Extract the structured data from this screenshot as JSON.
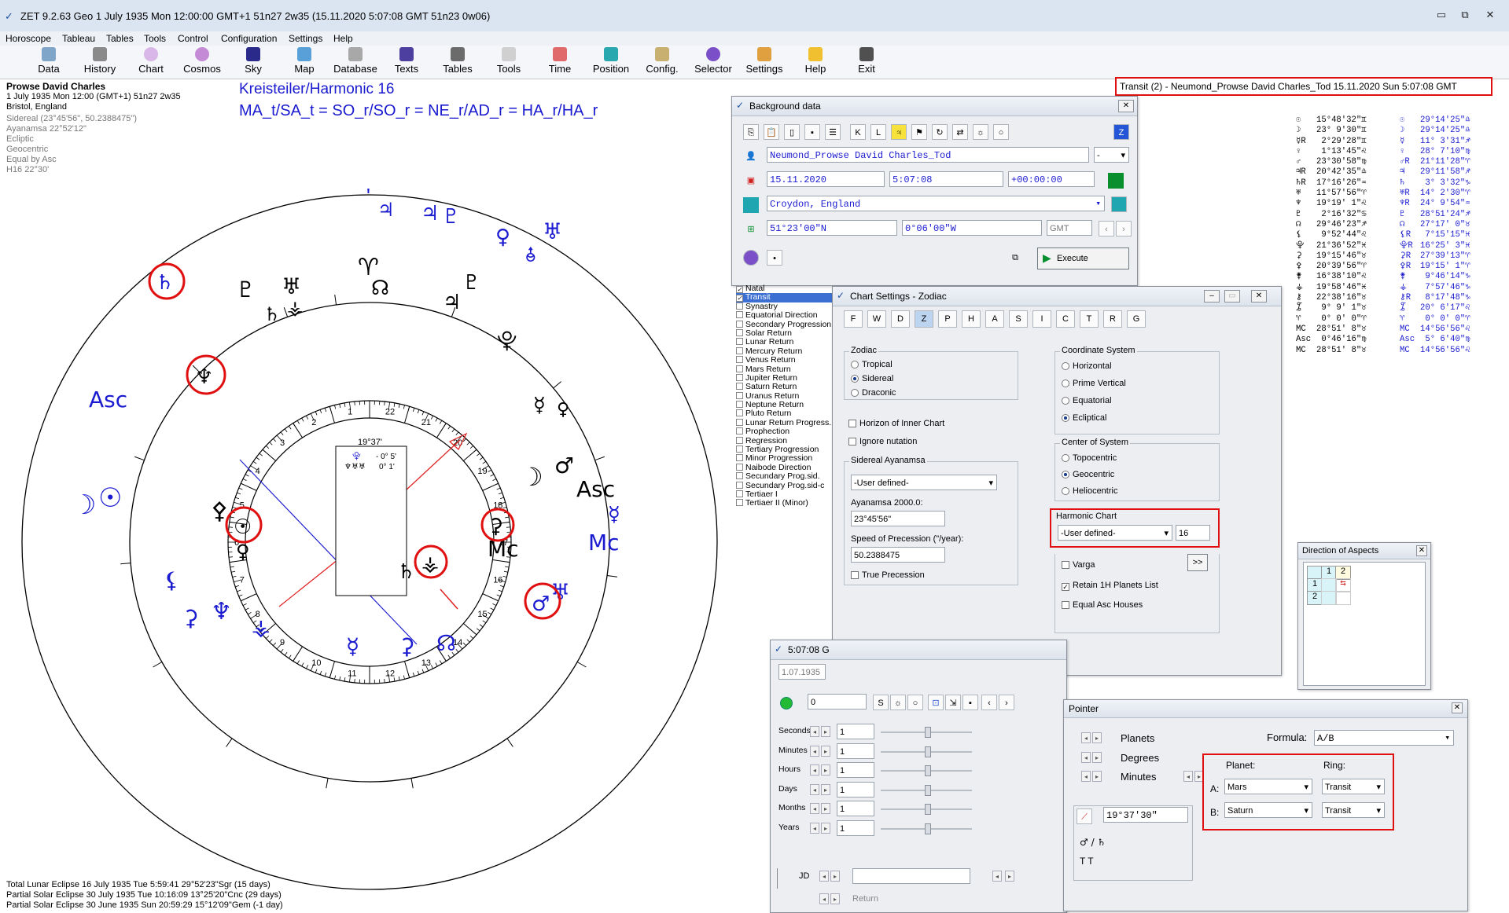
{
  "app": {
    "title": "ZET 9.2.63 Geo    1 July 1935   Mon   12:00:00 GMT+1  51n27   2w35   (15.11.2020    5:07:08 GMT  51n23  0w06)"
  },
  "menu": [
    "Horoscope",
    "Tableau",
    "Tables",
    "Tools",
    "Control",
    "Configuration",
    "Settings",
    "Help"
  ],
  "toolbar": [
    "Data",
    "History",
    "Chart",
    "Cosmos",
    "Sky",
    "Map",
    "Database",
    "Texts",
    "Tables",
    "Tools",
    "Time",
    "Position",
    "Config.",
    "Selector",
    "Settings",
    "Help",
    "Exit"
  ],
  "natal_info": {
    "name": "Prowse David Charles",
    "line1": "1 July 1935   Mon   12:00 (GMT+1)  51n27   2w35",
    "place": "Bristol, England",
    "details": [
      "Sidereal (23°45'56\", 50.2388475\")",
      "Ayanamsa 22°52'12\"",
      "Ecliptic",
      "Geocentric",
      "Equal by Asc",
      "H16  22°30'"
    ]
  },
  "heading": {
    "title": "Kreisteiler/Harmonic 16",
    "formula": "MA_t/SA_t = SO_r/SO_r = NE_r/AD_r = HA_r/HA_r"
  },
  "transit_label": "Transit (2) - Neumond_Prowse David Charles_Tod 15.11.2020   Sun   5:07:08 GMT",
  "chart": {
    "center_box": {
      "degree": "19°37'",
      "line1": "- 0° 5'",
      "line2": "0° 1'"
    },
    "house_numbers": [
      "1",
      "2",
      "3",
      "4",
      "5",
      "6",
      "7",
      "8",
      "9",
      "10",
      "11",
      "12",
      "13",
      "14",
      "15",
      "16",
      "17",
      "18",
      "19",
      "20",
      "21",
      "22"
    ],
    "axis_labels": {
      "asc_outer": "Asc",
      "mc_outer": "Mc",
      "asc_inner": "Asc",
      "mc_inner": "Mc"
    }
  },
  "eclipses": [
    "Total Lunar Eclipse 16 July 1935 Tue   5:59:41 29°52'23\"Sgr (15 days)",
    "Partial Solar Eclipse 30 July 1935 Tue 10:16:09 13°25'20\"Cnc (29 days)",
    "Partial Solar Eclipse 30 June 1935 Sun 20:59:29 15°12'09\"Gem (-1 day)"
  ],
  "positions_left": [
    {
      "glyph": "☉",
      "pos": "15°48'32\"♊"
    },
    {
      "glyph": "☽",
      "pos": "23° 9'30\"♊"
    },
    {
      "glyph": "☿R",
      "pos": " 2°29'28\"♊"
    },
    {
      "glyph": "♀",
      "pos": " 1°13'45\"♌"
    },
    {
      "glyph": "♂",
      "pos": "23°30'58\"♍"
    },
    {
      "glyph": "♃R",
      "pos": "20°42'35\"♎"
    },
    {
      "glyph": "♄R",
      "pos": "17°16'26\"♒"
    },
    {
      "glyph": "♅",
      "pos": "11°57'56\"♈"
    },
    {
      "glyph": "♆",
      "pos": "19°19' 1\"♌"
    },
    {
      "glyph": "♇",
      "pos": " 2°16'32\"♋"
    },
    {
      "glyph": "☊",
      "pos": "29°46'23\"♐"
    },
    {
      "glyph": "⚸",
      "pos": " 9°52'44\"♌"
    },
    {
      "glyph": "⯓",
      "pos": "21°36'52\"♓"
    },
    {
      "glyph": "⚳",
      "pos": "19°15'46\"♉"
    },
    {
      "glyph": "⚴",
      "pos": "20°39'56\"♈"
    },
    {
      "glyph": "⚵",
      "pos": "16°38'10\"♌"
    },
    {
      "glyph": "⚶",
      "pos": "19°58'46\"♓"
    },
    {
      "glyph": "⚷",
      "pos": "22°38'16\"♉"
    },
    {
      "glyph": "⯙",
      "pos": " 9° 9' 1\"♉"
    },
    {
      "glyph": "♈",
      "pos": " 0° 0' 0\"♈"
    },
    {
      "glyph": "MC",
      "pos": "28°51' 8\"♉"
    },
    {
      "glyph": "Asc",
      "pos": " 0°46'16\"♍"
    },
    {
      "glyph": "MC",
      "pos": "28°51' 8\"♉"
    }
  ],
  "positions_right": [
    {
      "glyph": "☉",
      "pos": "29°14'25\"♎"
    },
    {
      "glyph": "☽",
      "pos": "29°14'25\"♎"
    },
    {
      "glyph": "☿",
      "pos": "11° 3'31\"♐"
    },
    {
      "glyph": "♀",
      "pos": "28° 7'10\"♍"
    },
    {
      "glyph": "♂R",
      "pos": "21°11'28\"♈"
    },
    {
      "glyph": "♃",
      "pos": "29°11'58\"♐"
    },
    {
      "glyph": "♄",
      "pos": " 3° 3'32\"♑"
    },
    {
      "glyph": "♅R",
      "pos": "14° 2'30\"♈"
    },
    {
      "glyph": "♆R",
      "pos": "24° 9'54\"♒"
    },
    {
      "glyph": "♇",
      "pos": "28°51'24\"♐"
    },
    {
      "glyph": "☊",
      "pos": "27°17' 0\"♉"
    },
    {
      "glyph": "⚸R",
      "pos": " 7°15'15\"♓"
    },
    {
      "glyph": "⯓R",
      "pos": "16°25' 3\"♓"
    },
    {
      "glyph": "⚳R",
      "pos": "27°39'13\"♈"
    },
    {
      "glyph": "⚴R",
      "pos": "19°15' 1\"♈"
    },
    {
      "glyph": "⚵",
      "pos": " 9°46'14\"♑"
    },
    {
      "glyph": "⚶",
      "pos": " 7°57'46\"♑"
    },
    {
      "glyph": "⚷R",
      "pos": " 8°17'48\"♑"
    },
    {
      "glyph": "⯙",
      "pos": "20° 6'17\"♌"
    },
    {
      "glyph": "♈",
      "pos": " 0° 0' 0\"♈"
    },
    {
      "glyph": "MC",
      "pos": "14°56'56\"♌"
    },
    {
      "glyph": "Asc",
      "pos": " 5° 6'40\"♍"
    },
    {
      "glyph": "MC",
      "pos": "14°56'56\"♌"
    }
  ],
  "background_data": {
    "title": "Background data",
    "name": "Neumond_Prowse David Charles_Tod",
    "name_select": "-",
    "date": "15.11.2020",
    "time": "5:07:08",
    "offset": "+00:00:00",
    "place": "Croydon, England",
    "lat": "51°23'00\"N",
    "lon": "0°06'00\"W",
    "tz": "GMT",
    "execute": "Execute"
  },
  "chart_types": [
    "Natal",
    "Transit",
    "Synastry",
    "Equatorial Direction",
    "Secondary Progression",
    "Solar Return",
    "Lunar Return",
    "Mercury Return",
    "Venus Return",
    "Mars Return",
    "Jupiter Return",
    "Saturn Return",
    "Uranus Return",
    "Neptune Return",
    "Pluto Return",
    "Lunar Return Progress.",
    "Prophection",
    "Regression",
    "Tertiary Progression",
    "Minor Progression",
    "Naibode Direction",
    "Secundary Prog.sid.",
    "Secundary Prog.sid-c",
    "Tertiaer I",
    "Tertiaer II (Minor)"
  ],
  "chart_settings": {
    "title": "Chart Settings - Zodiac",
    "zodiac_label": "Zodiac",
    "zodiac_options": [
      "Tropical",
      "Sidereal",
      "Draconic"
    ],
    "zodiac_selected": 1,
    "horizon": "Horizon of Inner Chart",
    "ignore_nutation": "Ignore nutation",
    "ayanamsa_group": "Sidereal Ayanamsa",
    "ayanamsa_select": "-User defined-",
    "ayanamsa_label": "Ayanamsa 2000.0:",
    "ayanamsa_value": "23°45'56\"",
    "precession_label": "Speed of Precession (\"/year):",
    "precession_value": "50.2388475",
    "true_precession": "True Precession",
    "coord_label": "Coordinate System",
    "coord_options": [
      "Horizontal",
      "Prime Vertical",
      "Equatorial",
      "Ecliptical"
    ],
    "coord_selected": 3,
    "center_label": "Center of System",
    "center_options": [
      "Topocentric",
      "Geocentric",
      "Heliocentric"
    ],
    "center_selected": 1,
    "harmonic_label": "Harmonic Chart",
    "harmonic_select": "-User defined-",
    "harmonic_value": "16",
    "varga": "Varga",
    "varga_btn": ">>",
    "retain": "Retain 1H Planets List",
    "equal_asc": "Equal Asc Houses",
    "tabs": [
      "F",
      "W",
      "D",
      "Z",
      "P",
      "H",
      "A",
      "S",
      "I",
      "C",
      "T",
      "R",
      "G"
    ]
  },
  "time_dialog": {
    "title": "5:07:08 G",
    "date": "1.07.1935",
    "step": "0",
    "rows": [
      {
        "label": "Seconds",
        "value": "1"
      },
      {
        "label": "Minutes",
        "value": "1"
      },
      {
        "label": "Hours",
        "value": "1"
      },
      {
        "label": "Days",
        "value": "1"
      },
      {
        "label": "Months",
        "value": "1"
      },
      {
        "label": "Years",
        "value": "1"
      }
    ],
    "jd_label": "JD",
    "return_label": "Return"
  },
  "direction_aspects": {
    "title": "Direction of Aspects",
    "cols": [
      "1",
      "2"
    ],
    "rows": [
      "1",
      "2"
    ]
  },
  "pointer": {
    "title": "Pointer",
    "opts": [
      "Planets",
      "Degrees",
      "Minutes"
    ],
    "formula_label": "Formula:",
    "formula": "A/B",
    "value": "19°37'30\"",
    "pair": "♂ / ♄",
    "tt": "T   T",
    "planet_label": "Planet:",
    "ring_label": "Ring:",
    "a_label": "A:",
    "b_label": "B:",
    "a_planet": "Mars",
    "a_ring": "Transit",
    "b_planet": "Saturn",
    "b_ring": "Transit"
  },
  "colors": {
    "natal_blue": "#1a1ad0",
    "highlight_red": "#e01010",
    "chart_black": "#000000"
  }
}
